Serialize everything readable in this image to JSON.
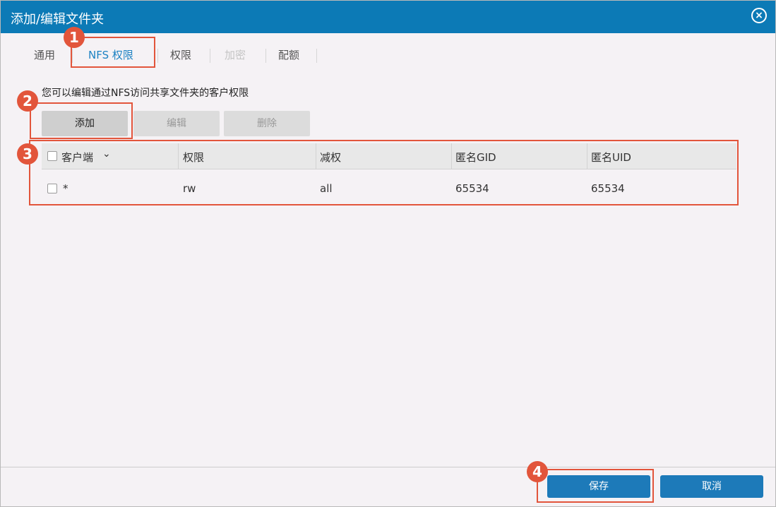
{
  "dialog": {
    "title": "添加/编辑文件夹",
    "close_icon": "close-circle-icon"
  },
  "tabs": [
    {
      "label": "通用",
      "state": "normal"
    },
    {
      "label": "NFS 权限",
      "state": "active"
    },
    {
      "label": "权限",
      "state": "normal"
    },
    {
      "label": "加密",
      "state": "disabled"
    },
    {
      "label": "配额",
      "state": "normal"
    }
  ],
  "description": "您可以编辑通过NFS访问共享文件夹的客户权限",
  "toolbar": {
    "add_label": "添加",
    "edit_label": "编辑",
    "delete_label": "删除"
  },
  "table": {
    "columns": [
      "客户端",
      "权限",
      "减权",
      "匿名GID",
      "匿名UID"
    ],
    "sort_icon": "chevron-down-icon",
    "rows": [
      {
        "client": "*",
        "permission": "rw",
        "squash": "all",
        "anon_gid": "65534",
        "anon_uid": "65534"
      }
    ]
  },
  "footer": {
    "save_label": "保存",
    "cancel_label": "取消"
  },
  "annotations": [
    "1",
    "2",
    "3",
    "4"
  ],
  "colors": {
    "titlebar": "#0c7ab6",
    "active_tab": "#1d82c3",
    "primary_button": "#1d7ab9",
    "annotation": "#e2553b"
  }
}
